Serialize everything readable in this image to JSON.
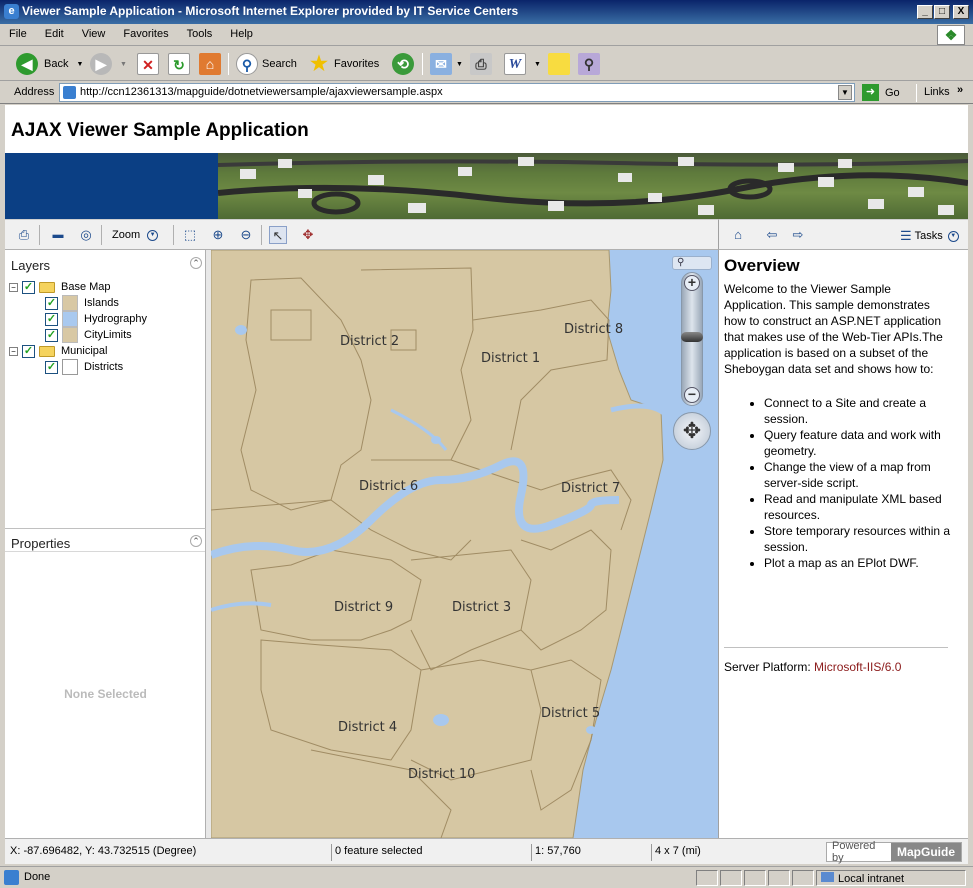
{
  "window": {
    "title": "Viewer Sample Application - Microsoft Internet Explorer provided by IT Service Centers",
    "min": "_",
    "max": "□",
    "close": "X"
  },
  "menu": [
    "File",
    "Edit",
    "View",
    "Favorites",
    "Tools",
    "Help"
  ],
  "toolbar": {
    "back": "Back",
    "search": "Search",
    "favorites": "Favorites"
  },
  "address": {
    "label": "Address",
    "url": "http://ccn12361313/mapguide/dotnetviewersample/ajaxviewersample.aspx",
    "go": "Go",
    "links": "Links"
  },
  "app": {
    "title": "AJAX Viewer Sample Application"
  },
  "viewer_toolbar": {
    "zoom": "Zoom",
    "tasks": "Tasks"
  },
  "legend": {
    "title": "Layers",
    "groups": [
      {
        "name": "Base Map",
        "layers": [
          "Islands",
          "Hydrography",
          "CityLimits"
        ]
      },
      {
        "name": "Municipal",
        "layers": [
          "Districts"
        ]
      }
    ],
    "swatch_colors": {
      "Islands": "#d8c8a4",
      "Hydrography": "#a9c9ef",
      "CityLimits": "#d8c8a4",
      "Districts": "#ffffff"
    }
  },
  "properties": {
    "title": "Properties",
    "empty": "None Selected"
  },
  "map": {
    "districts": [
      "District 1",
      "District 2",
      "District 3",
      "District 4",
      "District 5",
      "District 6",
      "District 7",
      "District 8",
      "District 9",
      "District 10"
    ],
    "land_color": "#d6c7a3",
    "water_color": "#a8c8ee",
    "zoom_level": 0.42
  },
  "taskpane": {
    "heading": "Overview",
    "intro": "Welcome to the Viewer Sample Application. This sample demonstrates how to construct an ASP.NET application that makes use of the Web-Tier APIs.The application is based on a subset of the Sheboygan data set and shows how to:",
    "bullets": [
      "Connect to a Site and create a session.",
      "Query feature data and work with geometry.",
      "Change the view of a map from server-side script.",
      "Read and manipulate XML based resources.",
      "Store temporary resources within a session.",
      "Plot a map as an EPlot DWF."
    ],
    "server_label": "Server Platform:",
    "server_value": "Microsoft-IIS/6.0"
  },
  "viewer_status": {
    "coords": "X: -87.696482, Y: 43.732515 (Degree)",
    "selected": "0 feature selected",
    "scale": "1: 57,760",
    "size": "4 x 7 (mi)",
    "powered": "Powered by",
    "brand": "MapGuide"
  },
  "ie_status": {
    "left": "Done",
    "zone": "Local intranet"
  }
}
